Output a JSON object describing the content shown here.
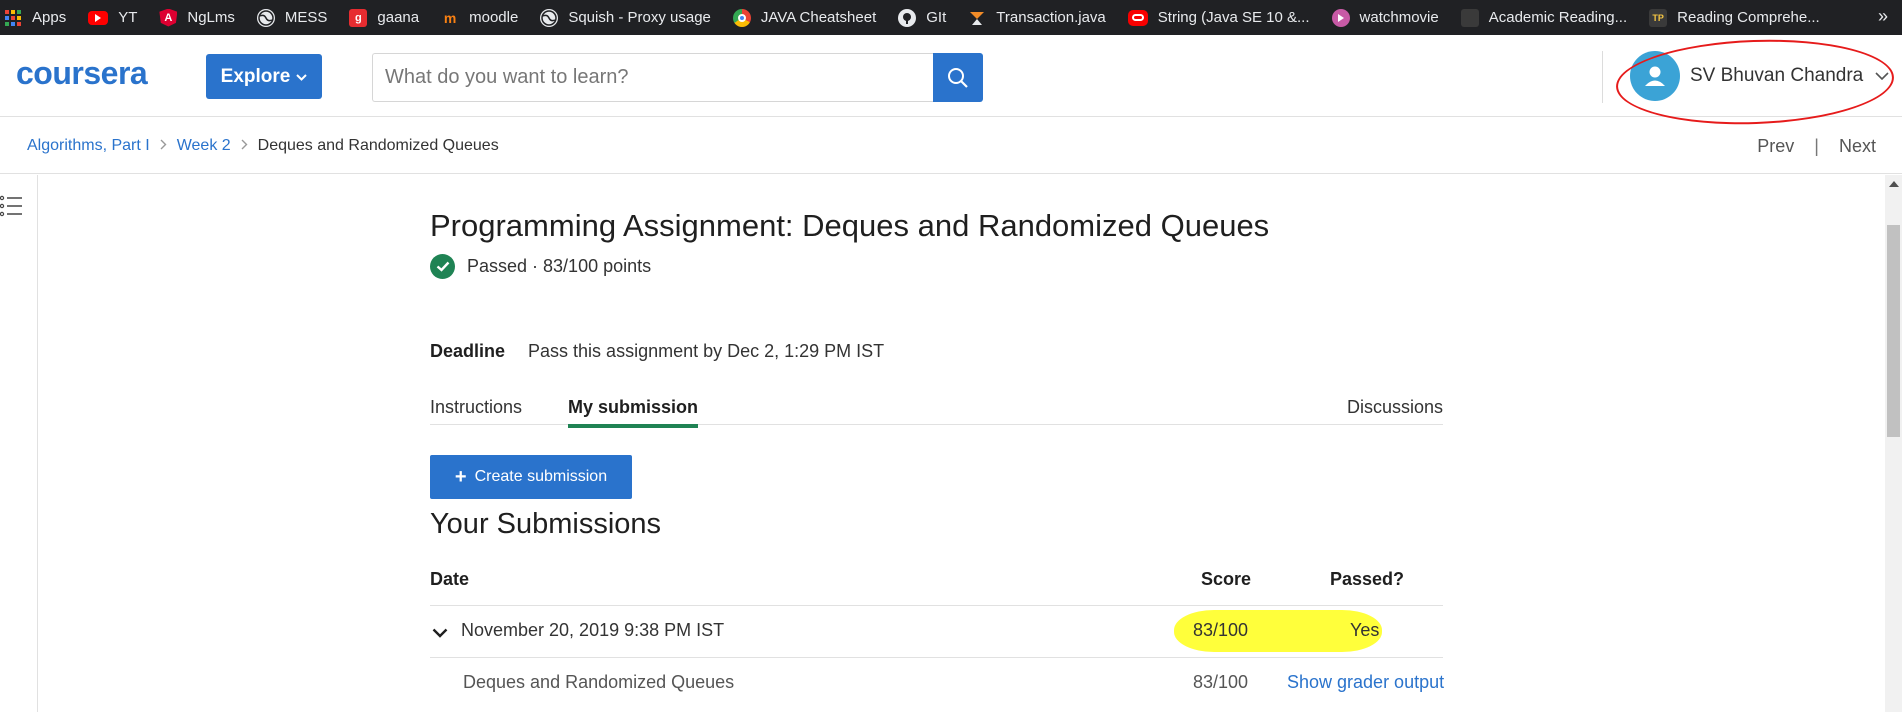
{
  "bookmarks": [
    {
      "label": "Apps",
      "icon": "apps-grid-icon",
      "color": "#4285f4"
    },
    {
      "label": "YT",
      "icon": "youtube-icon",
      "color": "#ff0000"
    },
    {
      "label": "NgLms",
      "icon": "angular-icon",
      "color": "#dd0031"
    },
    {
      "label": "MESS",
      "icon": "globe-icon",
      "color": "#e8eaed"
    },
    {
      "label": "gaana",
      "icon": "gaana-icon",
      "color": "#e72c30"
    },
    {
      "label": "moodle",
      "icon": "moodle-icon",
      "color": "#f98012"
    },
    {
      "label": "Squish - Proxy usage",
      "icon": "globe-icon",
      "color": "#e8eaed"
    },
    {
      "label": "JAVA Cheatsheet",
      "icon": "chrome-icon",
      "color": "#4285f4"
    },
    {
      "label": "GIt",
      "icon": "github-icon",
      "color": "#e8eaed"
    },
    {
      "label": "Transaction.java",
      "icon": "kotlin-icon",
      "color": "#f28c28"
    },
    {
      "label": "String (Java SE 10 &...",
      "icon": "oracle-icon",
      "color": "#f80000"
    },
    {
      "label": "watchmovie",
      "icon": "play-icon",
      "color": "#c85aa6"
    },
    {
      "label": "Academic Reading...",
      "icon": "grid-icon",
      "color": "#555555"
    },
    {
      "label": "Reading Comprehe...",
      "icon": "tp-icon",
      "color": "#333333"
    }
  ],
  "bookmarks_more": "»",
  "header": {
    "logo": "coursera",
    "explore_label": "Explore",
    "search_placeholder": "What do you want to learn?",
    "user_name": "SV Bhuvan Chandra"
  },
  "breadcrumb": {
    "items": [
      "Algorithms, Part I",
      "Week 2"
    ],
    "current": "Deques and Randomized Queues",
    "prev": "Prev",
    "next": "Next",
    "separator": "|"
  },
  "assignment": {
    "title": "Programming Assignment: Deques and Randomized Queues",
    "status": "Passed · 83/100 points",
    "deadline_label": "Deadline",
    "deadline_text": "Pass this assignment by Dec 2, 1:29 PM IST"
  },
  "tabs": {
    "instructions": "Instructions",
    "my_submission": "My submission",
    "discussions": "Discussions"
  },
  "create_submission_label": "Create submission",
  "submissions": {
    "title": "Your Submissions",
    "headers": {
      "date": "Date",
      "score": "Score",
      "passed": "Passed?"
    },
    "rows": [
      {
        "date": "November 20, 2019 9:38 PM IST",
        "score": "83/100",
        "passed": "Yes"
      }
    ],
    "detail": {
      "name": "Deques and Randomized Queues",
      "score": "83/100",
      "action": "Show grader output"
    }
  },
  "colors": {
    "brand": "#2a73cc",
    "success": "#1f8354",
    "highlight": "#ffff3b",
    "annotation": "#e61b1b"
  }
}
